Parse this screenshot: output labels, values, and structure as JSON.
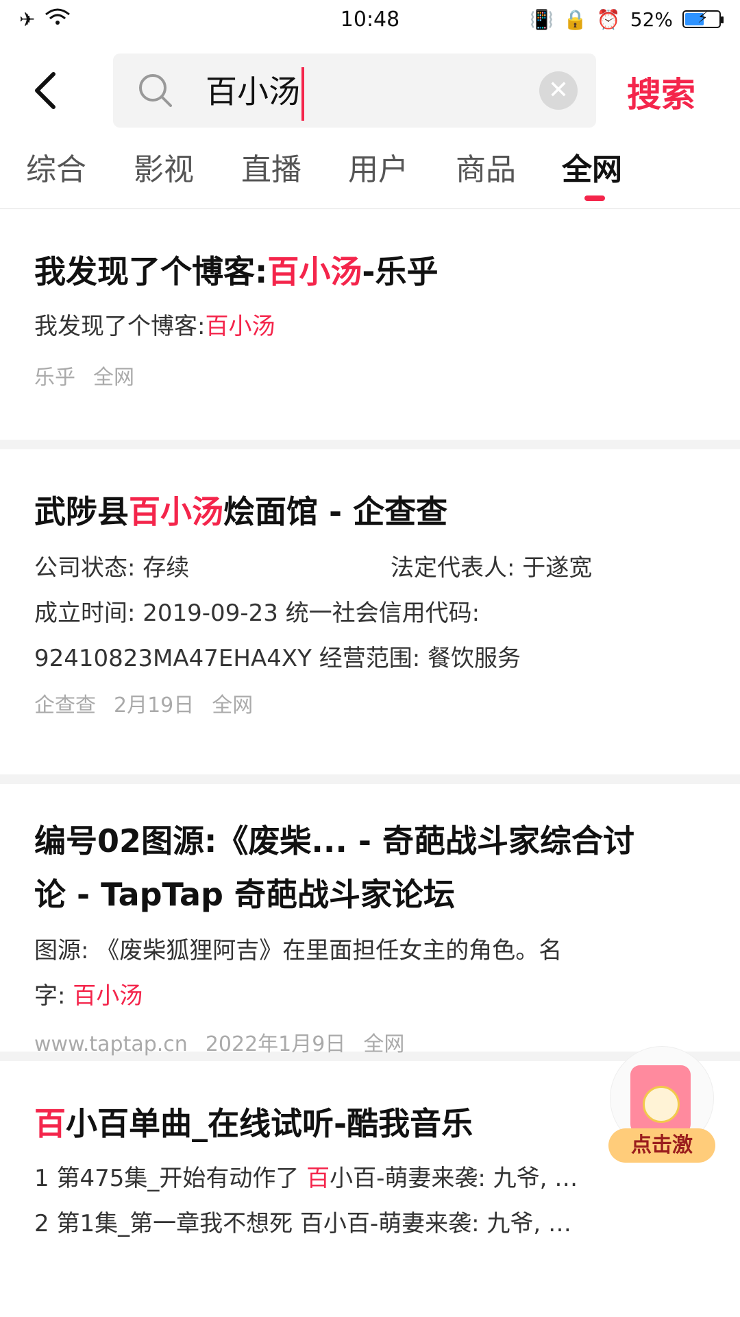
{
  "status": {
    "time": "10:48",
    "battery": "52%"
  },
  "search": {
    "back_icon": "chevron-left-icon",
    "query": "百小汤",
    "submit_label": "搜索"
  },
  "tabs": [
    "综合",
    "影视",
    "直播",
    "用户",
    "商品",
    "全网"
  ],
  "results": [
    {
      "title_pre": "我发现了个博客:",
      "title_hl": "百小汤",
      "title_post": "-乐乎",
      "desc_pre": "我发现了个博客:",
      "desc_hl": "百小汤",
      "meta_source": "乐乎",
      "meta_tag": "全网"
    },
    {
      "title_pre": "武陟县",
      "title_hl": "百小汤",
      "title_post": "烩面馆 - 企查查",
      "status_label": "公司状态: 存续",
      "rep_label": "法定代表人: 于遂宽",
      "line2": "成立时间: 2019-09-23 统一社会信用代码:",
      "line3": "92410823MA47EHA4XY 经营范围: 餐饮服务",
      "meta_source": "企查查",
      "meta_date": "2月19日",
      "meta_tag": "全网"
    },
    {
      "title_line1": "编号02图源:《废柴... - 奇葩战斗家综合讨",
      "title_line2": "论 - TapTap 奇葩战斗家论坛",
      "desc_line1": "图源: 《废柴狐狸阿吉》在里面担任女主的角色。名",
      "desc_line2_pre": "字: ",
      "desc_line2_hl": "百小汤",
      "meta_source": "www.taptap.cn",
      "meta_date": "2022年1月9日",
      "meta_tag": "全网"
    },
    {
      "title_hl": "百",
      "title_post": "小百单曲_在线试听-酷我音乐",
      "line1_pre": "1 第475集_开始有动作了 ",
      "line1_hl": "百",
      "line1_post": "小百-萌妻来袭: 九爷, …",
      "line2": "2 第1集_第一章我不想死 百小百-萌妻来袭: 九爷, …"
    }
  ],
  "float_badge": {
    "label": "点击激"
  }
}
